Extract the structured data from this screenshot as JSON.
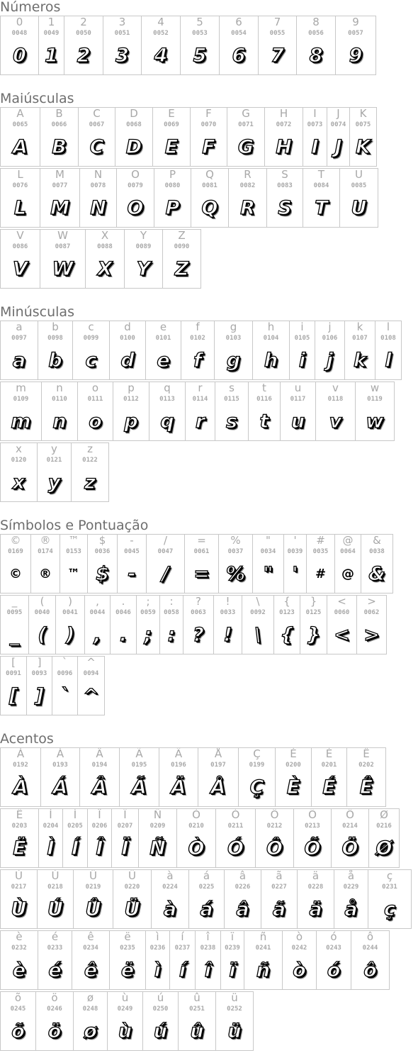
{
  "sections": [
    {
      "title": "Números",
      "rows": [
        [
          {
            "ch": "0",
            "code": "0048"
          },
          {
            "ch": "1",
            "code": "0049"
          },
          {
            "ch": "2",
            "code": "0050"
          },
          {
            "ch": "3",
            "code": "0051"
          },
          {
            "ch": "4",
            "code": "0052"
          },
          {
            "ch": "5",
            "code": "0053"
          },
          {
            "ch": "6",
            "code": "0054"
          },
          {
            "ch": "7",
            "code": "0055"
          },
          {
            "ch": "8",
            "code": "0056"
          },
          {
            "ch": "9",
            "code": "0057"
          }
        ]
      ]
    },
    {
      "title": "Maiúsculas",
      "rows": [
        [
          {
            "ch": "A",
            "code": "0065"
          },
          {
            "ch": "B",
            "code": "0066"
          },
          {
            "ch": "C",
            "code": "0067"
          },
          {
            "ch": "D",
            "code": "0068"
          },
          {
            "ch": "E",
            "code": "0069"
          },
          {
            "ch": "F",
            "code": "0070"
          },
          {
            "ch": "G",
            "code": "0071"
          },
          {
            "ch": "H",
            "code": "0072"
          },
          {
            "ch": "I",
            "code": "0073"
          },
          {
            "ch": "J",
            "code": "0074"
          },
          {
            "ch": "K",
            "code": "0075"
          }
        ],
        [
          {
            "ch": "L",
            "code": "0076"
          },
          {
            "ch": "M",
            "code": "0077"
          },
          {
            "ch": "N",
            "code": "0078"
          },
          {
            "ch": "O",
            "code": "0079"
          },
          {
            "ch": "P",
            "code": "0080"
          },
          {
            "ch": "Q",
            "code": "0081"
          },
          {
            "ch": "R",
            "code": "0082"
          },
          {
            "ch": "S",
            "code": "0083"
          },
          {
            "ch": "T",
            "code": "0084"
          },
          {
            "ch": "U",
            "code": "0085"
          }
        ],
        [
          {
            "ch": "V",
            "code": "0086"
          },
          {
            "ch": "W",
            "code": "0087"
          },
          {
            "ch": "X",
            "code": "0088"
          },
          {
            "ch": "Y",
            "code": "0089"
          },
          {
            "ch": "Z",
            "code": "0090"
          }
        ]
      ]
    },
    {
      "title": "Minúsculas",
      "rows": [
        [
          {
            "ch": "a",
            "code": "0097"
          },
          {
            "ch": "b",
            "code": "0098"
          },
          {
            "ch": "c",
            "code": "0099"
          },
          {
            "ch": "d",
            "code": "0100"
          },
          {
            "ch": "e",
            "code": "0101"
          },
          {
            "ch": "f",
            "code": "0102"
          },
          {
            "ch": "g",
            "code": "0103"
          },
          {
            "ch": "h",
            "code": "0104"
          },
          {
            "ch": "i",
            "code": "0105"
          },
          {
            "ch": "j",
            "code": "0106"
          },
          {
            "ch": "k",
            "code": "0107"
          },
          {
            "ch": "l",
            "code": "0108"
          }
        ],
        [
          {
            "ch": "m",
            "code": "0109"
          },
          {
            "ch": "n",
            "code": "0110"
          },
          {
            "ch": "o",
            "code": "0111"
          },
          {
            "ch": "p",
            "code": "0112"
          },
          {
            "ch": "q",
            "code": "0113"
          },
          {
            "ch": "r",
            "code": "0114"
          },
          {
            "ch": "s",
            "code": "0115"
          },
          {
            "ch": "t",
            "code": "0116"
          },
          {
            "ch": "u",
            "code": "0117"
          },
          {
            "ch": "v",
            "code": "0118"
          },
          {
            "ch": "w",
            "code": "0119"
          }
        ],
        [
          {
            "ch": "x",
            "code": "0120"
          },
          {
            "ch": "y",
            "code": "0121"
          },
          {
            "ch": "z",
            "code": "0122"
          }
        ]
      ]
    },
    {
      "title": "Símbolos e Pontuação",
      "rows": [
        [
          {
            "ch": "©",
            "code": "0169",
            "plain": true
          },
          {
            "ch": "®",
            "code": "0174",
            "plain": true
          },
          {
            "ch": "™",
            "code": "0153",
            "plain": true
          },
          {
            "ch": "$",
            "code": "0036"
          },
          {
            "ch": "-",
            "code": "0045"
          },
          {
            "ch": "/",
            "code": "0047"
          },
          {
            "ch": "=",
            "code": "0061"
          },
          {
            "ch": "%",
            "code": "0037"
          },
          {
            "ch": "\"",
            "code": "0034"
          },
          {
            "ch": "'",
            "code": "0039"
          },
          {
            "ch": "#",
            "code": "0035",
            "plain": true
          },
          {
            "ch": "@",
            "code": "0064",
            "plain": true
          },
          {
            "ch": "&",
            "code": "0038"
          }
        ],
        [
          {
            "ch": "_",
            "code": "0095"
          },
          {
            "ch": "(",
            "code": "0040"
          },
          {
            "ch": ")",
            "code": "0041"
          },
          {
            "ch": ",",
            "code": "0044"
          },
          {
            "ch": ".",
            "code": "0046"
          },
          {
            "ch": ";",
            "code": "0059"
          },
          {
            "ch": ":",
            "code": "0058"
          },
          {
            "ch": "?",
            "code": "0063"
          },
          {
            "ch": "!",
            "code": "0033"
          },
          {
            "ch": "\\",
            "code": "0092"
          },
          {
            "ch": "{",
            "code": "0123"
          },
          {
            "ch": "}",
            "code": "0125"
          },
          {
            "ch": "<",
            "code": "0060"
          },
          {
            "ch": ">",
            "code": "0062"
          }
        ],
        [
          {
            "ch": "[",
            "code": "0091"
          },
          {
            "ch": "]",
            "code": "0093"
          },
          {
            "ch": "`",
            "code": "0096"
          },
          {
            "ch": "^",
            "code": "0094"
          }
        ]
      ]
    },
    {
      "title": "Acentos",
      "rows": [
        [
          {
            "ch": "À",
            "code": "0192"
          },
          {
            "ch": "Á",
            "code": "0193"
          },
          {
            "ch": "Â",
            "code": "0194"
          },
          {
            "ch": "Ã",
            "code": "0195"
          },
          {
            "ch": "Ä",
            "code": "0196"
          },
          {
            "ch": "Å",
            "code": "0197"
          },
          {
            "ch": "Ç",
            "code": "0199"
          },
          {
            "ch": "È",
            "code": "0200"
          },
          {
            "ch": "É",
            "code": "0201"
          },
          {
            "ch": "Ê",
            "code": "0202"
          }
        ],
        [
          {
            "ch": "Ë",
            "code": "0203"
          },
          {
            "ch": "Ì",
            "code": "0204"
          },
          {
            "ch": "Í",
            "code": "0205"
          },
          {
            "ch": "Î",
            "code": "0206"
          },
          {
            "ch": "Ï",
            "code": "0207"
          },
          {
            "ch": "Ñ",
            "code": "0209"
          },
          {
            "ch": "Ò",
            "code": "0210"
          },
          {
            "ch": "Ó",
            "code": "0211"
          },
          {
            "ch": "Ô",
            "code": "0212"
          },
          {
            "ch": "Õ",
            "code": "0213"
          },
          {
            "ch": "Ö",
            "code": "0214"
          },
          {
            "ch": "Ø",
            "code": "0216"
          }
        ],
        [
          {
            "ch": "Ù",
            "code": "0217"
          },
          {
            "ch": "Ú",
            "code": "0218"
          },
          {
            "ch": "Û",
            "code": "0219"
          },
          {
            "ch": "Ü",
            "code": "0220"
          },
          {
            "ch": "à",
            "code": "0224"
          },
          {
            "ch": "á",
            "code": "0225"
          },
          {
            "ch": "â",
            "code": "0226"
          },
          {
            "ch": "ã",
            "code": "0227"
          },
          {
            "ch": "ä",
            "code": "0228"
          },
          {
            "ch": "å",
            "code": "0229"
          },
          {
            "ch": "ç",
            "code": "0231"
          }
        ],
        [
          {
            "ch": "è",
            "code": "0232"
          },
          {
            "ch": "é",
            "code": "0233"
          },
          {
            "ch": "ê",
            "code": "0234"
          },
          {
            "ch": "ë",
            "code": "0235"
          },
          {
            "ch": "ì",
            "code": "0236"
          },
          {
            "ch": "í",
            "code": "0237"
          },
          {
            "ch": "î",
            "code": "0238"
          },
          {
            "ch": "ï",
            "code": "0239"
          },
          {
            "ch": "ñ",
            "code": "0241"
          },
          {
            "ch": "ò",
            "code": "0242"
          },
          {
            "ch": "ó",
            "code": "0243"
          },
          {
            "ch": "ô",
            "code": "0244"
          }
        ],
        [
          {
            "ch": "õ",
            "code": "0245"
          },
          {
            "ch": "ö",
            "code": "0246"
          },
          {
            "ch": "ø",
            "code": "0248"
          },
          {
            "ch": "ù",
            "code": "0249"
          },
          {
            "ch": "ú",
            "code": "0250"
          },
          {
            "ch": "û",
            "code": "0251"
          },
          {
            "ch": "ü",
            "code": "0252"
          }
        ]
      ]
    }
  ]
}
